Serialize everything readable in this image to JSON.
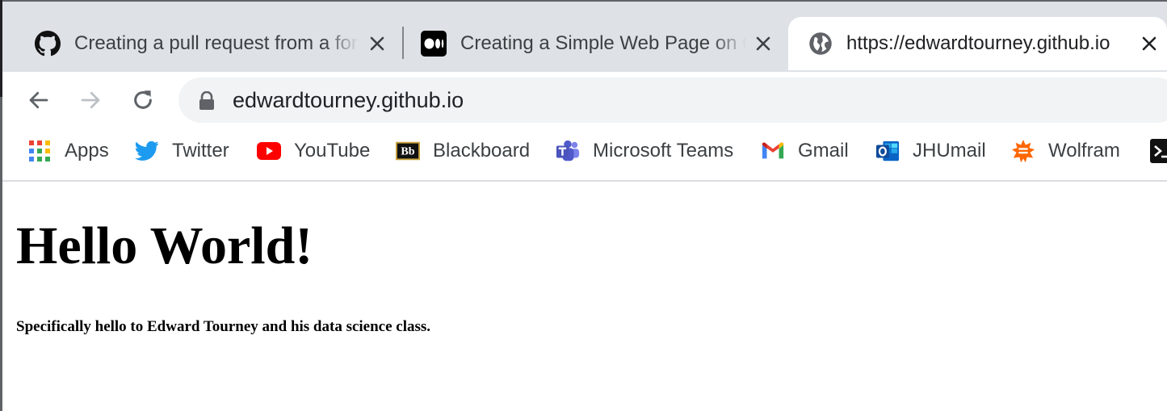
{
  "tabs": [
    {
      "title": "Creating a pull request from a fork",
      "icon": "github-icon",
      "active": false
    },
    {
      "title": "Creating a Simple Web Page on GitHub",
      "icon": "medium-icon",
      "active": false
    },
    {
      "title": "https://edwardtourney.github.io",
      "icon": "globe-icon",
      "active": true
    }
  ],
  "toolbar": {
    "back": "back-arrow-icon",
    "forward": "forward-arrow-icon",
    "reload": "reload-icon",
    "url": "edwardtourney.github.io"
  },
  "bookmarks": [
    {
      "label": "Apps",
      "icon": "apps-grid-icon"
    },
    {
      "label": "Twitter",
      "icon": "twitter-icon"
    },
    {
      "label": "YouTube",
      "icon": "youtube-icon"
    },
    {
      "label": "Blackboard",
      "icon": "blackboard-icon"
    },
    {
      "label": "Microsoft Teams",
      "icon": "teams-icon"
    },
    {
      "label": "Gmail",
      "icon": "gmail-icon"
    },
    {
      "label": "JHUmail",
      "icon": "outlook-icon"
    },
    {
      "label": "Wolfram",
      "icon": "wolfram-icon"
    },
    {
      "label": "",
      "icon": "terminal-icon"
    }
  ],
  "page": {
    "heading": "Hello World!",
    "subheading": "Specifically hello to Edward Tourney and his data science class."
  },
  "colors": {
    "tabstrip": "#dee1e6",
    "omnibox": "#f1f3f4",
    "twitter": "#1d9bf0",
    "youtube": "#ff0000",
    "teams": "#5059c9",
    "outlook": "#0a64c6",
    "wolfram": "#ff6600"
  }
}
